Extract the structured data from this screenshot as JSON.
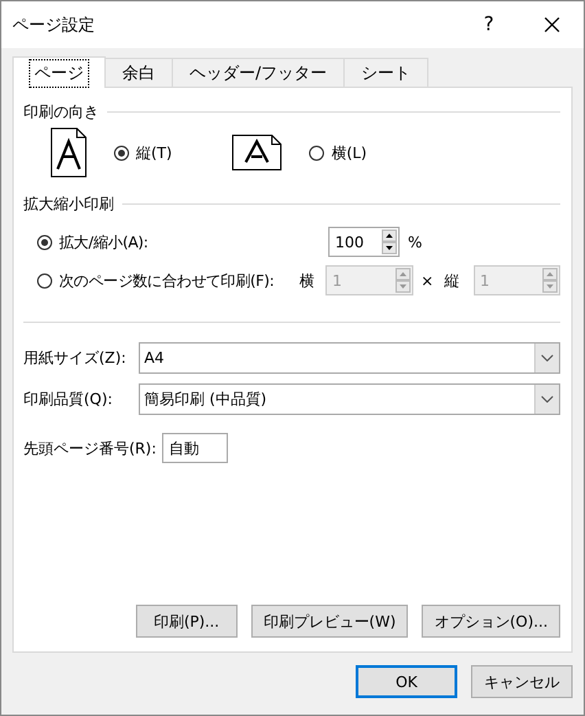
{
  "window": {
    "title": "ページ設定",
    "help": "?"
  },
  "tabs": [
    {
      "label": "ページ",
      "selected": true
    },
    {
      "label": "余白",
      "selected": false
    },
    {
      "label": "ヘッダー/フッター",
      "selected": false
    },
    {
      "label": "シート",
      "selected": false
    }
  ],
  "orientation": {
    "title": "印刷の向き",
    "options": [
      {
        "label": "縦(T)",
        "selected": true,
        "kind": "portrait"
      },
      {
        "label": "横(L)",
        "selected": false,
        "kind": "landscape"
      }
    ]
  },
  "scaling": {
    "title": "拡大縮小印刷",
    "options": [
      {
        "label": "拡大/縮小(A):",
        "selected": true
      },
      {
        "label": "次のページ数に合わせて印刷(F):",
        "selected": false
      }
    ],
    "zoom": {
      "value": "100",
      "unit": "%"
    },
    "fit": {
      "wide_label": "横",
      "wide_value": "1",
      "separator": "×",
      "tall_label": "縦",
      "tall_value": "1",
      "disabled": true
    }
  },
  "paper_size": {
    "label": "用紙サイズ(Z):",
    "value": "A4"
  },
  "print_quality": {
    "label": "印刷品質(Q):",
    "value": "簡易印刷 (中品質)"
  },
  "first_page": {
    "label": "先頭ページ番号(R):",
    "value": "自動"
  },
  "actions": [
    "印刷(P)...",
    "印刷プレビュー(W)",
    "オプション(O)..."
  ],
  "buttons": [
    {
      "label": "OK",
      "default": true
    },
    {
      "label": "キャンセル",
      "default": false
    }
  ]
}
